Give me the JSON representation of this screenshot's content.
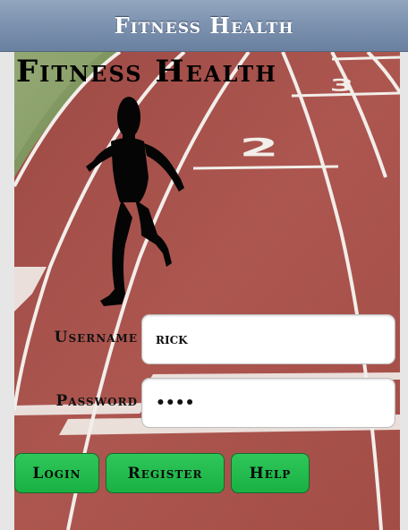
{
  "header": {
    "title": "Fitness Health"
  },
  "brand": {
    "heading": "Fitness Health"
  },
  "login_form": {
    "username_label": "Username",
    "username_value": "rick",
    "password_label": "Password",
    "password_value": "rick"
  },
  "actions": {
    "login_label": "Login",
    "register_label": "Register",
    "help_label": "Help"
  },
  "colors": {
    "titlebar": "#7d93b0",
    "button_green": "#1fb84b",
    "track_red": "#a8524c"
  },
  "scene": {
    "lane_number_2": "2",
    "lane_number_3": "3"
  }
}
